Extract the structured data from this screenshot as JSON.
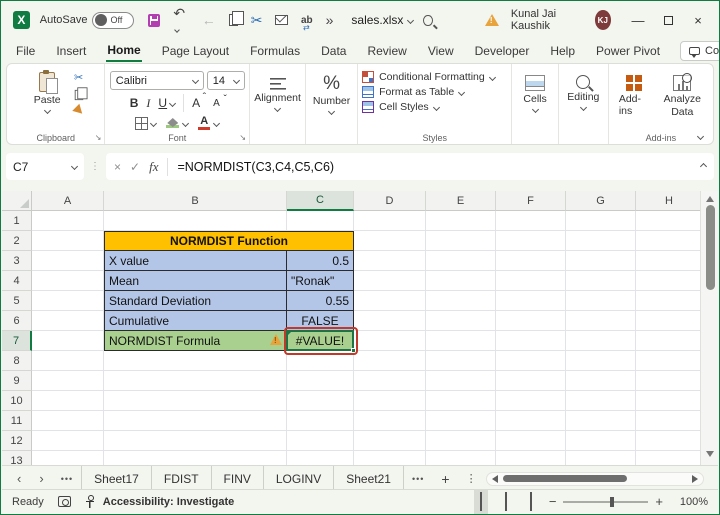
{
  "titlebar": {
    "autosave_label": "AutoSave",
    "autosave_state": "Off",
    "filename": "sales.xlsx",
    "user_name": "Kunal Jai Kaushik",
    "user_initials": "KJ"
  },
  "tabs": {
    "items": [
      "File",
      "Insert",
      "Home",
      "Page Layout",
      "Formulas",
      "Data",
      "Review",
      "View",
      "Developer",
      "Help",
      "Power Pivot"
    ],
    "active": "Home",
    "comments_label": "Comments"
  },
  "ribbon": {
    "clipboard": {
      "paste": "Paste",
      "group": "Clipboard"
    },
    "font": {
      "name": "Calibri",
      "size": "14",
      "bold": "B",
      "italic": "I",
      "underline": "U",
      "grow": "A",
      "shrink": "A",
      "color_a": "A",
      "group": "Font"
    },
    "alignment_label": "Alignment",
    "number_label": "Number",
    "styles": {
      "conditional_formatting": "Conditional Formatting",
      "format_as_table": "Format as Table",
      "cell_styles": "Cell Styles",
      "group": "Styles"
    },
    "cells_label": "Cells",
    "editing_label": "Editing",
    "addins": {
      "addins_label": "Add-ins",
      "analyze_label": "Analyze Data",
      "group": "Add-ins"
    }
  },
  "formula_bar": {
    "name_box": "C7",
    "fx": "fx",
    "formula": "=NORMDIST(C3,C4,C5,C6)"
  },
  "grid": {
    "columns": [
      "A",
      "B",
      "C",
      "D",
      "E",
      "F",
      "G",
      "H"
    ],
    "row_count": 13,
    "selected_column": "C",
    "selected_row": 7,
    "table": {
      "title": "NORMDIST Function",
      "rows": [
        {
          "label": "X value",
          "value": "0.5",
          "align": "right"
        },
        {
          "label": "Mean",
          "value": "\"Ronak\"",
          "align": "left"
        },
        {
          "label": "Standard Deviation",
          "value": "0.55",
          "align": "right"
        },
        {
          "label": "Cumulative",
          "value": "FALSE",
          "align": "center"
        },
        {
          "label": "NORMDIST Formula",
          "value": "#VALUE!",
          "align": "center",
          "error": true
        }
      ]
    }
  },
  "sheet_bar": {
    "tabs": [
      "Sheet17",
      "FDIST",
      "FINV",
      "LOGINV",
      "Sheet21"
    ]
  },
  "status_bar": {
    "ready": "Ready",
    "accessibility": "Accessibility: Investigate",
    "zoom": "100%"
  },
  "colors": {
    "excel_green": "#107C41",
    "header_gold": "#FFC000",
    "fill_blue": "#B4C6E7",
    "fill_green": "#A9D08E",
    "annotation_red": "#C0392B"
  }
}
